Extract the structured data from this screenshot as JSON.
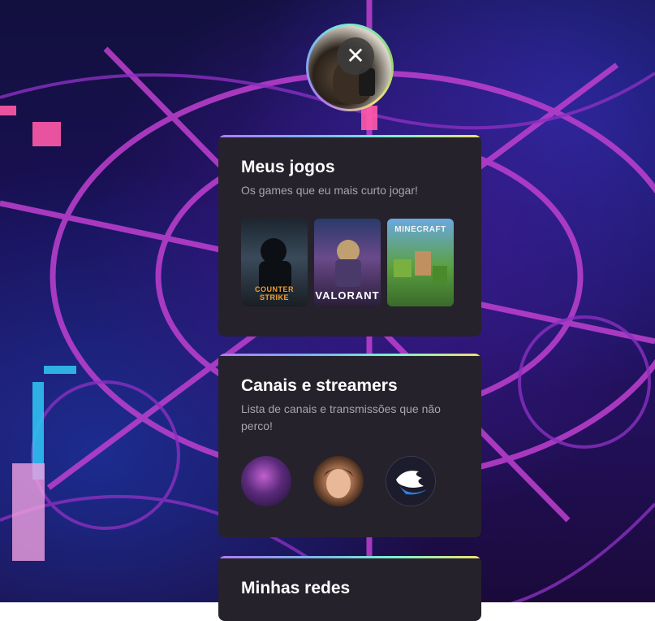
{
  "profile": {
    "close_symbol": "✕"
  },
  "cards": {
    "games": {
      "title": "Meus jogos",
      "subtitle": "Os games que eu mais curto jogar!",
      "items": [
        {
          "label": "COUNTER STRIKE",
          "icon": "counter-strike-cover"
        },
        {
          "label": "VALORANT",
          "icon": "valorant-cover"
        },
        {
          "label": "MINECRAFT",
          "icon": "minecraft-cover"
        }
      ]
    },
    "streamers": {
      "title": "Canais e streamers",
      "subtitle": "Lista de canais e transmissões que não perco!"
    },
    "networks": {
      "title": "Minhas redes"
    }
  },
  "colors": {
    "card_bg": "#26222c",
    "accent_gradient": [
      "#b07cf0",
      "#7cb0f0",
      "#7cf0d0",
      "#f0e070"
    ]
  }
}
